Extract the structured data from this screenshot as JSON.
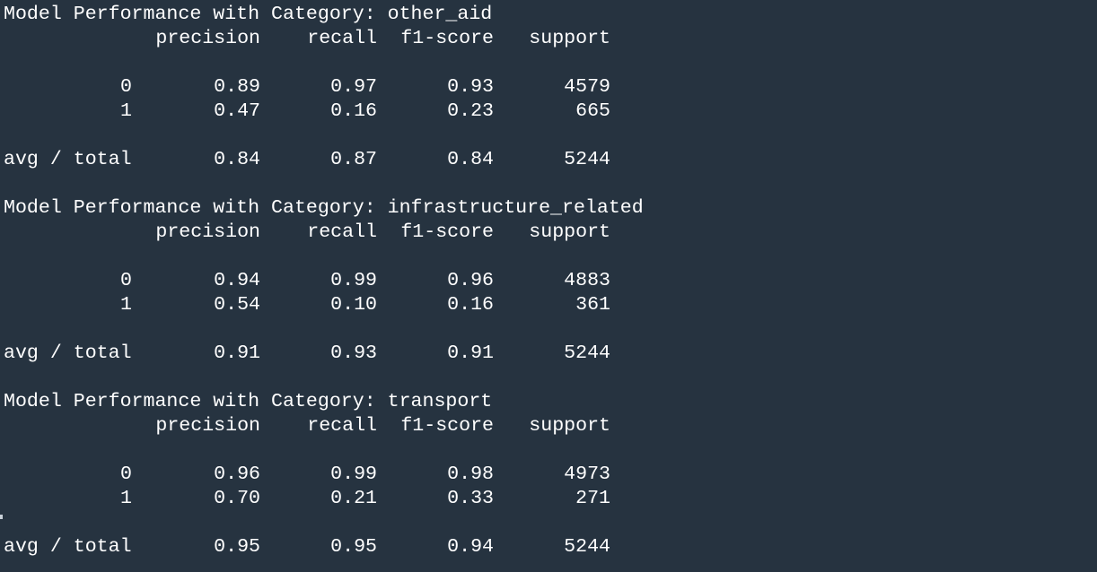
{
  "headers": {
    "precision": "precision",
    "recall": "recall",
    "f1": "f1-score",
    "support": "support"
  },
  "avg_label": "avg / total",
  "blocks": [
    {
      "title": "Model Performance with Category: other_aid",
      "rows": [
        {
          "label": "0",
          "precision": "0.89",
          "recall": "0.97",
          "f1": "0.93",
          "support": "4579"
        },
        {
          "label": "1",
          "precision": "0.47",
          "recall": "0.16",
          "f1": "0.23",
          "support": "665"
        }
      ],
      "avg": {
        "precision": "0.84",
        "recall": "0.87",
        "f1": "0.84",
        "support": "5244"
      }
    },
    {
      "title": "Model Performance with Category: infrastructure_related",
      "rows": [
        {
          "label": "0",
          "precision": "0.94",
          "recall": "0.99",
          "f1": "0.96",
          "support": "4883"
        },
        {
          "label": "1",
          "precision": "0.54",
          "recall": "0.10",
          "f1": "0.16",
          "support": "361"
        }
      ],
      "avg": {
        "precision": "0.91",
        "recall": "0.93",
        "f1": "0.91",
        "support": "5244"
      }
    },
    {
      "title": "Model Performance with Category: transport",
      "rows": [
        {
          "label": "0",
          "precision": "0.96",
          "recall": "0.99",
          "f1": "0.98",
          "support": "4973"
        },
        {
          "label": "1",
          "precision": "0.70",
          "recall": "0.21",
          "f1": "0.33",
          "support": "271"
        }
      ],
      "avg": {
        "precision": "0.95",
        "recall": "0.95",
        "f1": "0.94",
        "support": "5244"
      }
    }
  ]
}
